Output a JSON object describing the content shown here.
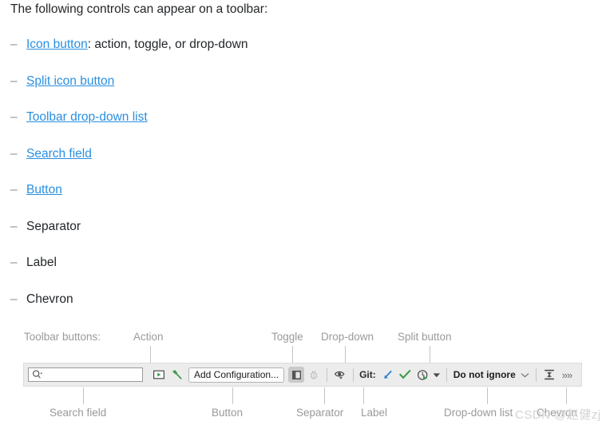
{
  "intro": {
    "text": "The following controls can appear on a toolbar:"
  },
  "list": {
    "dash": "–",
    "items": [
      {
        "link": "Icon button",
        "rest": ": action, toggle, or drop-down",
        "is_link": true
      },
      {
        "link": "Split icon button",
        "rest": "",
        "is_link": true
      },
      {
        "link": "Toolbar drop-down list",
        "rest": "",
        "is_link": true
      },
      {
        "link": "Search field",
        "rest": "",
        "is_link": true
      },
      {
        "link": "Button",
        "rest": "",
        "is_link": true
      },
      {
        "link": "",
        "rest": "Separator",
        "is_link": false
      },
      {
        "link": "",
        "rest": "Label",
        "is_link": false
      },
      {
        "link": "",
        "rest": "Chevron",
        "is_link": false
      }
    ]
  },
  "diagram": {
    "callouts_top": [
      {
        "label": "Toolbar buttons:",
        "has_leader": false
      },
      {
        "label": "Action",
        "has_leader": true
      },
      {
        "label": "Toggle",
        "has_leader": true
      },
      {
        "label": "Drop-down",
        "has_leader": true
      },
      {
        "label": "Split button",
        "has_leader": true
      }
    ],
    "callouts_bottom": [
      {
        "label": "Search field"
      },
      {
        "label": "Button"
      },
      {
        "label": "Separator"
      },
      {
        "label": "Label"
      },
      {
        "label": "Drop-down list"
      },
      {
        "label": "Chevron"
      }
    ],
    "toolbar": {
      "search_placeholder": "",
      "search_icon": "search-magnifier-icon",
      "run_icon": "run-action-icon",
      "build_icon": "build-hammer-icon",
      "button_label": "Add Configuration...",
      "toggle_icon": "toggle-panel-icon",
      "debug_icon": "debug-bug-icon",
      "inspect_icon": "eye-inspect-dropdown-icon",
      "git_label": "Git:",
      "update_icon": "update-project-arrow-icon",
      "commit_icon": "commit-checkmark-icon",
      "history_icon": "run-history-split-icon",
      "dropdown_value": "Do not ignore",
      "collapse_icon": "expand-collapse-icon",
      "chevron_more": "»»"
    },
    "colors": {
      "link": "#2a8fe0",
      "callout": "#9a9a9a",
      "toolbar_bg": "#ececec",
      "green": "#3c9a46",
      "blue": "#2f7fd0"
    }
  },
  "watermark": {
    "text": "CSDN @赵健zj"
  }
}
